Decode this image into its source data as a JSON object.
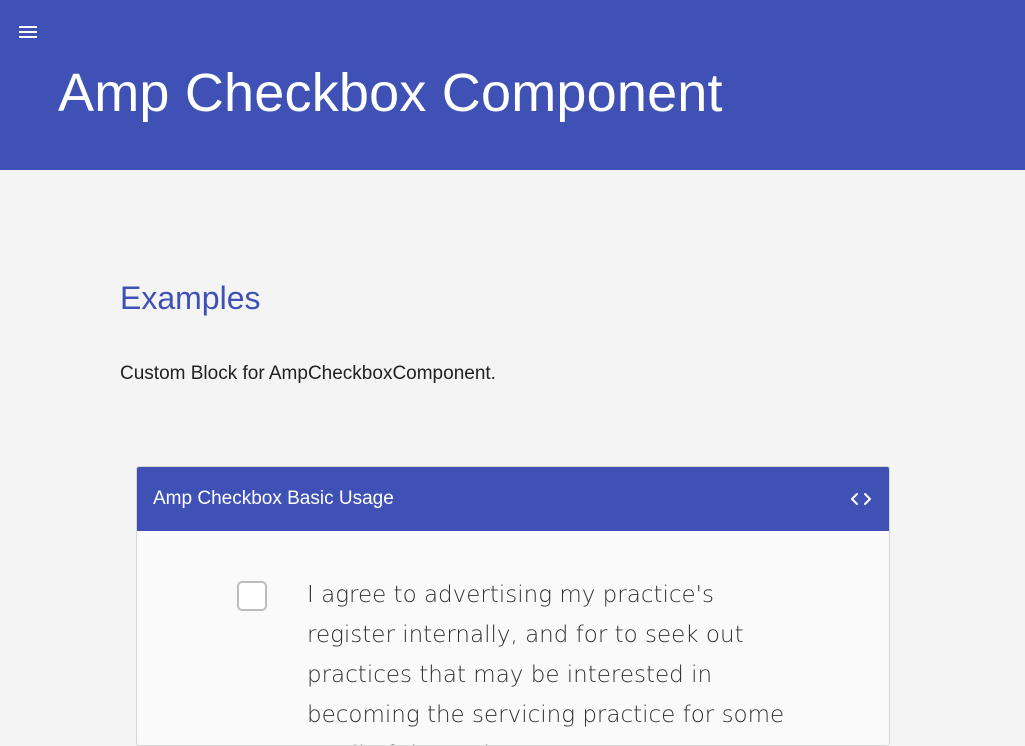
{
  "header": {
    "menu_icon": "hamburger-menu-icon",
    "title": "Amp Checkbox Component",
    "background_color": "#3f51b5"
  },
  "main": {
    "section_title": "Examples",
    "section_description": "Custom Block for AmpCheckboxComponent.",
    "example_card": {
      "title": "Amp Checkbox Basic Usage",
      "code_toggle_icon": "code-brackets-icon",
      "checkbox": {
        "checked": false,
        "label": "I agree to advertising my practice's register internally, and for to seek out practices that may be interested in becoming the servicing practice for some or all of the register."
      }
    }
  },
  "colors": {
    "accent": "#3f51b5",
    "page_background": "#f4f4f4",
    "text": "#212121"
  }
}
